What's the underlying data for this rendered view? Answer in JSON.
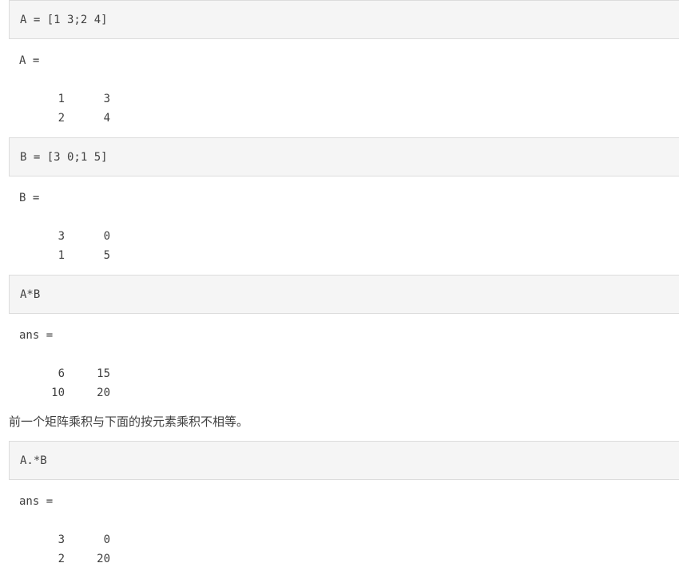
{
  "blocks": [
    {
      "code": "A = [1 3;2 4]",
      "label": "A =",
      "rows": [
        [
          "1",
          "3"
        ],
        [
          "2",
          "4"
        ]
      ]
    },
    {
      "code": "B = [3 0;1 5]",
      "label": "B =",
      "rows": [
        [
          "3",
          "0"
        ],
        [
          "1",
          "5"
        ]
      ]
    },
    {
      "code": "A*B",
      "label": "ans =",
      "rows": [
        [
          "6",
          "15"
        ],
        [
          "10",
          "20"
        ]
      ]
    },
    {
      "code": "A.*B",
      "label": "ans =",
      "rows": [
        [
          "3",
          "0"
        ],
        [
          "2",
          "20"
        ]
      ]
    }
  ],
  "prose": "前一个矩阵乘积与下面的按元素乘积不相等。"
}
